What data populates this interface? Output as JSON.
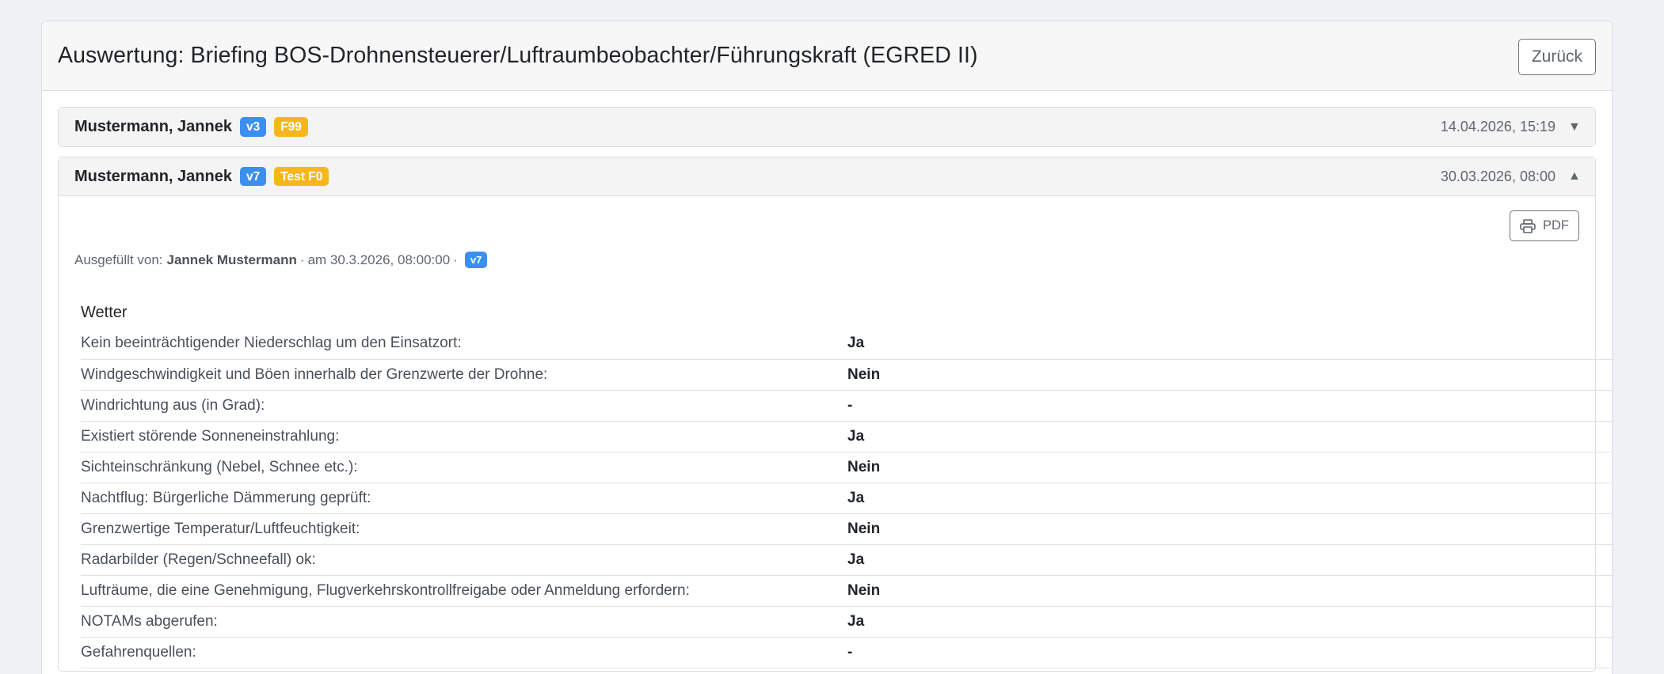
{
  "header": {
    "title": "Auswertung: Briefing BOS-Drohnensteuerer/Luftraumbeobachter/Führungskraft (EGRED II)",
    "back_label": "Zurück"
  },
  "items": [
    {
      "name": "Mustermann, Jannek",
      "version": "v3",
      "tag": "F99",
      "datetime": "14.04.2026, 15:19",
      "caret": "▼"
    },
    {
      "name": "Mustermann, Jannek",
      "version": "v7",
      "tag": "Test F0",
      "datetime": "30.03.2026, 08:00",
      "caret": "▲",
      "pdf_label": "PDF",
      "meta": {
        "prefix": "Ausgefüllt von:",
        "person": "Jannek Mustermann",
        "separator": "·",
        "date_text": "am 30.3.2026, 08:00:00",
        "separator2": "·",
        "version": "v7"
      },
      "section_title": "Wetter",
      "rows": [
        {
          "q": "Kein beeinträchtigender Niederschlag um den Einsatzort:",
          "a": "Ja"
        },
        {
          "q": "Windgeschwindigkeit und Böen innerhalb der Grenzwerte der Drohne:",
          "a": "Nein"
        },
        {
          "q": "Windrichtung aus (in Grad):",
          "a": "-"
        },
        {
          "q": "Existiert störende Sonneneinstrahlung:",
          "a": "Ja"
        },
        {
          "q": "Sichteinschränkung (Nebel, Schnee etc.):",
          "a": "Nein"
        },
        {
          "q": "Nachtflug: Bürgerliche Dämmerung geprüft:",
          "a": "Ja"
        },
        {
          "q": "Grenzwertige Temperatur/Luftfeuchtigkeit:",
          "a": "Nein"
        },
        {
          "q": "Radarbilder (Regen/Schneefall) ok:",
          "a": "Ja"
        },
        {
          "q": "Lufträume, die eine Genehmigung, Flugverkehrskontrollfreigabe oder Anmeldung erfordern:",
          "a": "Nein"
        },
        {
          "q": "NOTAMs abgerufen:",
          "a": "Ja"
        },
        {
          "q": "Gefahrenquellen:",
          "a": "-"
        }
      ]
    }
  ]
}
